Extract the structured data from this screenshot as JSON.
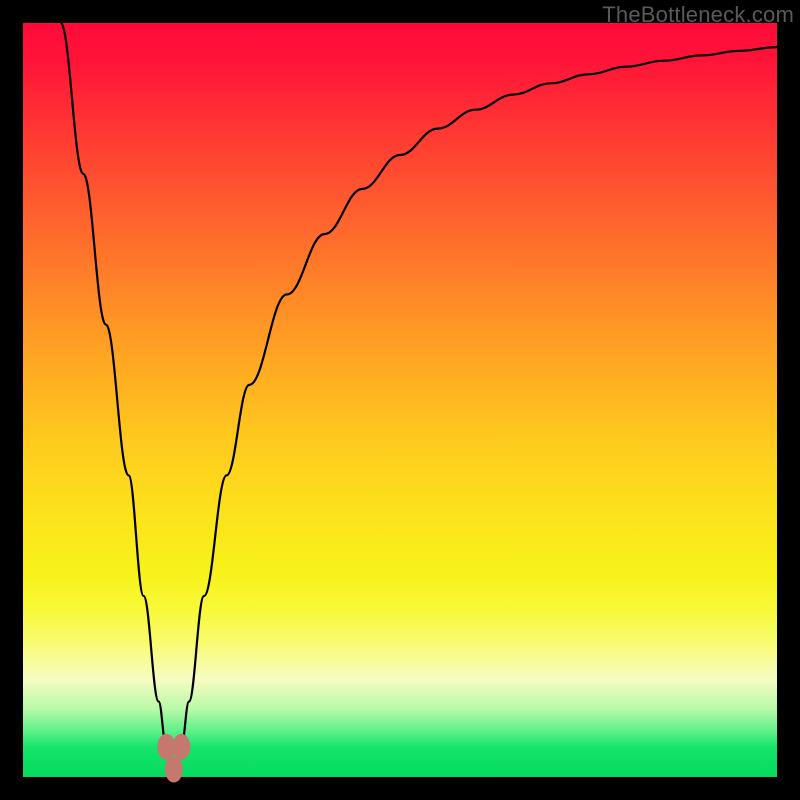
{
  "watermark": "TheBottleneck.com",
  "colors": {
    "frame": "#000000",
    "curve": "#000000",
    "marker": "#c5786d",
    "gradient_top": "#ff0a3a",
    "gradient_bottom": "#04db5e"
  },
  "chart_data": {
    "type": "line",
    "title": "",
    "xlabel": "",
    "ylabel": "",
    "xlim": [
      0,
      100
    ],
    "ylim": [
      0,
      100
    ],
    "grid": false,
    "legend": false,
    "series": [
      {
        "name": "bottleneck-curve",
        "x": [
          5,
          8,
          11,
          14,
          16,
          18,
          19,
          20,
          21,
          22,
          24,
          27,
          30,
          35,
          40,
          45,
          50,
          55,
          60,
          65,
          70,
          75,
          80,
          85,
          90,
          95,
          100
        ],
        "y": [
          100,
          80,
          60,
          40,
          24,
          10,
          4,
          1,
          4,
          10,
          24,
          40,
          52,
          64,
          72,
          78,
          82.5,
          86,
          88.5,
          90.5,
          92,
          93.2,
          94.2,
          95,
          95.7,
          96.3,
          96.8
        ]
      }
    ],
    "markers": [
      {
        "name": "cusp-left",
        "x": 19,
        "y": 4
      },
      {
        "name": "cusp-min",
        "x": 20,
        "y": 1
      },
      {
        "name": "cusp-right",
        "x": 21,
        "y": 4
      }
    ]
  }
}
